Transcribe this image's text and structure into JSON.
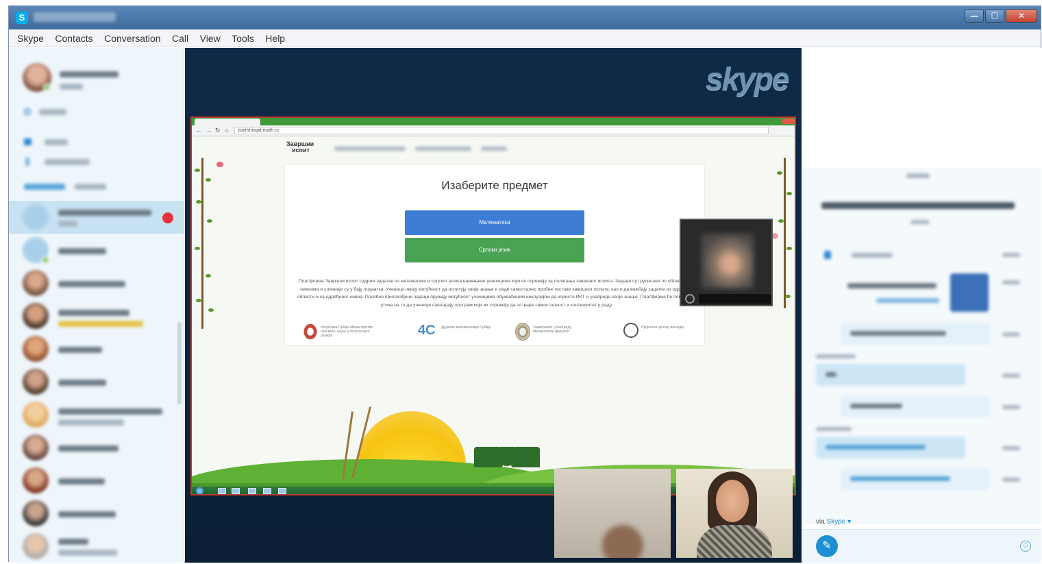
{
  "window": {
    "title_icon": "S",
    "min": "—",
    "max": "☐",
    "close": "✕"
  },
  "menu": [
    "Skype",
    "Contacts",
    "Conversation",
    "Call",
    "View",
    "Tools",
    "Help"
  ],
  "stage": {
    "brand": "skype"
  },
  "shared_screen": {
    "address": "zavrsniispit.math.rs",
    "site_logo_line1": "Завршни",
    "site_logo_line2": "испит",
    "heading": "Изаберите предмет",
    "btn_math": "Математика",
    "btn_serbian": "Српски језик",
    "description": "Платформа Завршни испит садржи задатке из математике и српског језика намењене ученицима који се спремају за полагање завршног испита. Задаци су груписани по областима и нивоима и сличнији су у бају подаатка. Ученици имају могућност да испитују своје знање и раде самостално пробне тестове завршног испита, као и да вежбају задатке из одређене области и са одређеног нивоа. Посебно прилагођени задаци пружају могућност ученицима обухваћеним инклузијом да користе ИКТ и унапреде своје знање. Платформа ће помоћи да утиче на то да ученици савладају програм који их спремају да остваре самосталност и континуитет у раду.",
    "partners": [
      {
        "label": "Република Србија Министарство просвете, науке и технолошког развоја",
        "color": "#c64a3a"
      },
      {
        "label": "Друштво математичара Србије",
        "color": "#4a8fd6"
      },
      {
        "label": "Универзитет у Београду Математички факултет",
        "color": "#9a8a6a"
      },
      {
        "label": "Пројектни центар Агенција",
        "color": "#555555"
      }
    ]
  },
  "chat": {
    "via_prefix": "via",
    "via_brand": "Skype ▾",
    "attach_icon": "✎",
    "emoji_icon": "☺"
  },
  "colors": {
    "accent": "#00aff0",
    "stage": "#0e2a47",
    "math_button": "#3d7dd6",
    "serbian_button": "#4aa354",
    "end_call": "#e8323c"
  }
}
